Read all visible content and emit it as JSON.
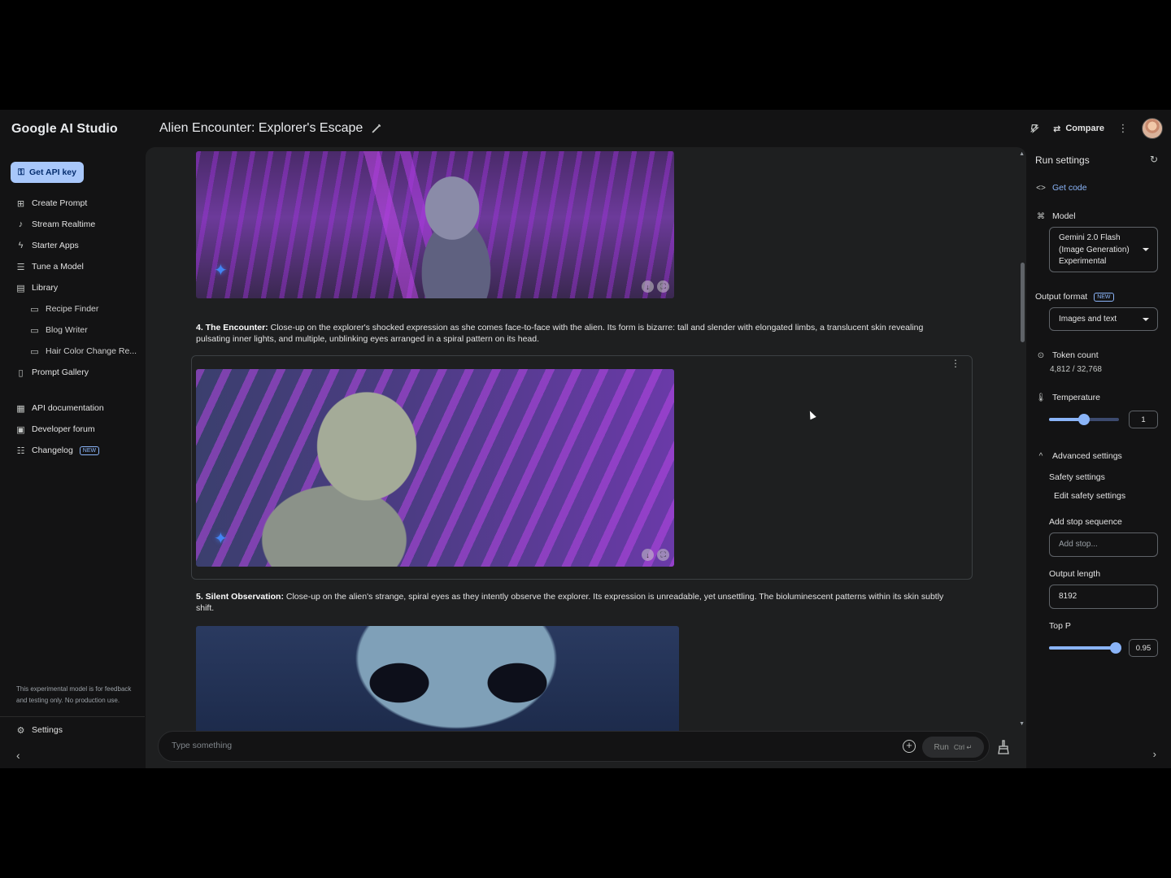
{
  "app": {
    "brand": "Google AI Studio",
    "doc_title": "Alien Encounter: Explorer's Escape"
  },
  "header": {
    "compare_label": "Compare"
  },
  "sidebar": {
    "api_key_label": "Get API key",
    "items": [
      {
        "label": "Create Prompt",
        "icon": "create-prompt-icon"
      },
      {
        "label": "Stream Realtime",
        "icon": "microphone-icon"
      },
      {
        "label": "Starter Apps",
        "icon": "bolt-icon"
      },
      {
        "label": "Tune a Model",
        "icon": "tune-icon"
      },
      {
        "label": "Library",
        "icon": "library-icon"
      },
      {
        "label": "Recipe Finder",
        "icon": "chat-icon"
      },
      {
        "label": "Blog Writer",
        "icon": "chat-icon"
      },
      {
        "label": "Hair Color Change Re...",
        "icon": "chat-icon"
      },
      {
        "label": "Prompt Gallery",
        "icon": "gallery-icon"
      },
      {
        "label": "API documentation",
        "icon": "doc-icon"
      },
      {
        "label": "Developer forum",
        "icon": "forum-icon"
      },
      {
        "label": "Changelog",
        "icon": "changelog-icon",
        "badge": "NEW"
      }
    ],
    "disclaimer": "This experimental model is for feedback and testing only. No production use.",
    "settings_label": "Settings"
  },
  "chat": {
    "para1_bold": "4. The Encounter:",
    "para1_text": " Close-up on the explorer's shocked expression as she comes face-to-face with the alien. Its form is bizarre: tall and slender with elongated limbs, a translucent skin revealing pulsating inner lights, and multiple, unblinking eyes arranged in a spiral pattern on its head.",
    "para2_bold": "5. Silent Observation:",
    "para2_text": " Close-up on the alien's strange, spiral eyes as they intently observe the explorer. Its expression is unreadable, yet unsettling. The bioluminescent patterns within its skin subtly shift.",
    "composer_placeholder": "Type something",
    "run_label": "Run",
    "run_shortcut": "Ctrl ↵"
  },
  "run_settings": {
    "title": "Run settings",
    "get_code": "Get code",
    "model_label": "Model",
    "model_value": "Gemini 2.0 Flash (Image Generation) Experimental",
    "output_format_label": "Output format",
    "output_format_badge": "NEW",
    "output_format_value": "Images and text",
    "token_count_label": "Token count",
    "token_count_value": "4,812 / 32,768",
    "temperature_label": "Temperature",
    "temperature_value": "1",
    "temperature_fraction": 0.5,
    "advanced_label": "Advanced settings",
    "safety_label": "Safety settings",
    "edit_safety": "Edit safety settings",
    "stop_seq_label": "Add stop sequence",
    "stop_seq_placeholder": "Add stop...",
    "output_length_label": "Output length",
    "output_length_value": "8192",
    "top_p_label": "Top P",
    "top_p_value": "0.95",
    "top_p_fraction": 0.95
  }
}
